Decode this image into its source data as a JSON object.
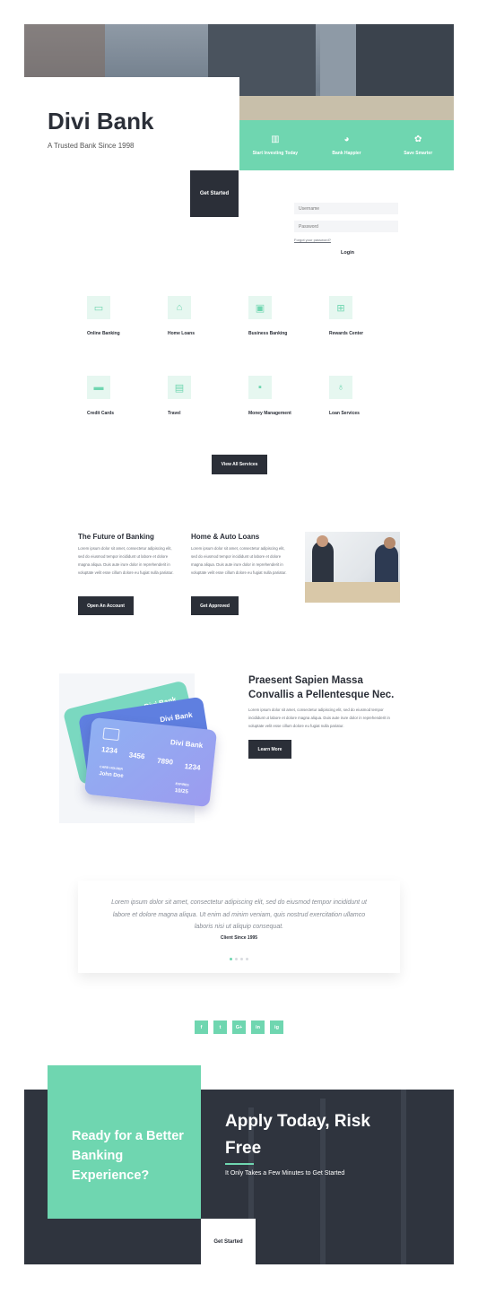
{
  "colors": {
    "accent": "#6fd6b0",
    "dark": "#2b2f38",
    "cta_bg": "#2f343e",
    "light_mint": "#e6f7f0"
  },
  "hero": {
    "title": "Divi Bank",
    "subtitle": "A Trusted Bank Since 1998",
    "features": [
      {
        "icon": "chart-icon",
        "label": "Start Investing Today"
      },
      {
        "icon": "pie-chart-icon",
        "label": "Bank Happier"
      },
      {
        "icon": "piggy-bank-icon",
        "label": "Save Smarter"
      }
    ],
    "cta_label": "Get Started"
  },
  "login": {
    "username_placeholder": "Username",
    "password_placeholder": "Password",
    "forgot_link": "Forgot your password?",
    "login_label": "Login"
  },
  "services": {
    "items": [
      {
        "icon": "monitor-icon",
        "label": "Online Banking"
      },
      {
        "icon": "house-icon",
        "label": "Home Loans"
      },
      {
        "icon": "briefcase-icon",
        "label": "Business Banking"
      },
      {
        "icon": "gift-icon",
        "label": "Rewards Center"
      },
      {
        "icon": "credit-card-icon",
        "label": "Credit Cards"
      },
      {
        "icon": "suitcase-icon",
        "label": "Travel"
      },
      {
        "icon": "money-icon",
        "label": "Money Management"
      },
      {
        "icon": "money-bag-icon",
        "label": "Loan Services"
      }
    ],
    "view_all_label": "View All Services"
  },
  "columns": [
    {
      "title": "The Future of Banking",
      "text": "Lorem ipsum dolor sit amet, consectetur adipiscing elit, sed do eiusmod tempor incididunt ut labore et dolore magna aliqua. Duis aute irure dolor in reprehenderit in voluptate velit esse cillum dolore eu fugiat nulla pariatur.",
      "button": "Open An Account"
    },
    {
      "title": "Home & Auto Loans",
      "text": "Lorem ipsum dolor sit amet, consectetur adipiscing elit, sed do eiusmod tempor incididunt ut labore et dolore magna aliqua. Duis aute irure dolor in reprehenderit in voluptate velit esse cillum dolore eu fugiat nulla pariatur.",
      "button": "Get Approved"
    }
  ],
  "cards_section": {
    "card_brand": "Divi Bank",
    "card_number": [
      "1234",
      "3456",
      "7890",
      "1234"
    ],
    "holder_label": "CARD HOLDER",
    "holder_name": "John Doe",
    "expires_label": "EXPIRES",
    "expires_value": "10/25",
    "title": "Praesent Sapien Massa Convallis a Pellentesque Nec.",
    "text": "Lorem ipsum dolor sit amet, consectetur adipiscing elit, sed do eiusmod tempor incididunt ut labore et dolore magna aliqua. Duis aute irure dolor in reprehenderit in voluptate velit esse cillum dolore eu fugiat nulla pariatur.",
    "button": "Learn More"
  },
  "testimonial": {
    "quote": "Lorem ipsum dolor sit amet, consectetur adipiscing elit, sed do eiusmod tempor incididunt ut labore et dolore magna aliqua. Ut enim ad minim veniam, quis nostrud exercitation ullamco laboris nisi ut aliquip consequat.",
    "author": "Client Since 1995"
  },
  "social": [
    "f",
    "t",
    "G+",
    "in",
    "ig"
  ],
  "cta": {
    "left_title": "Ready for a Better Banking Experience?",
    "right_title": "Apply Today, Risk Free",
    "subtitle": "It Only Takes a Few Minutes to Get Started",
    "button": "Get Started"
  }
}
